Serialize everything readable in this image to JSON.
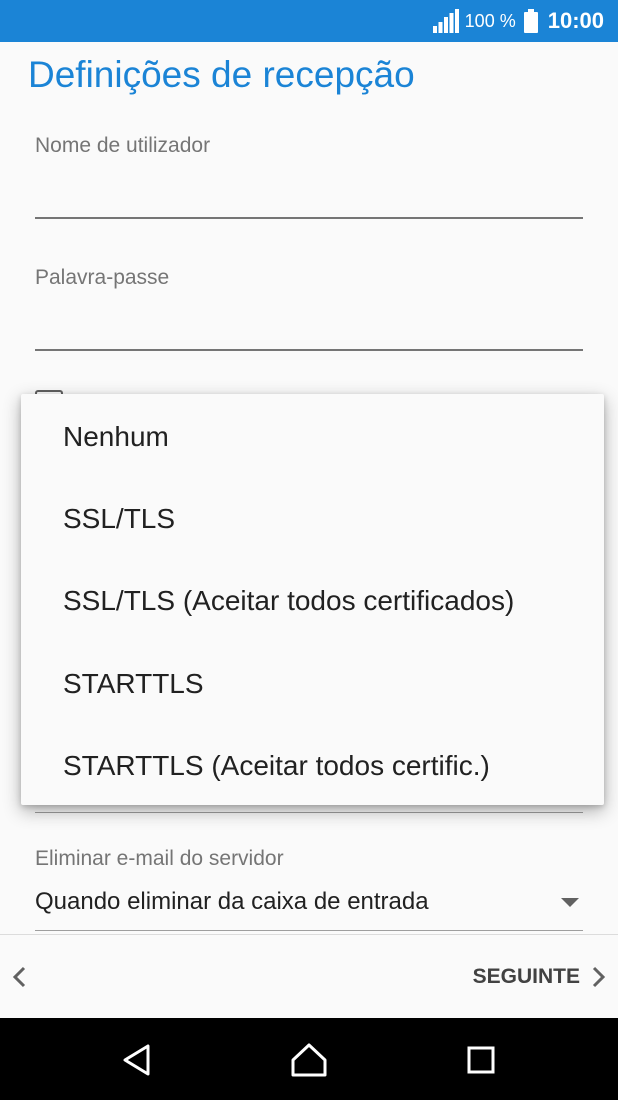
{
  "status_bar": {
    "battery_percent": "100 %",
    "time": "10:00",
    "signal_icon": "signal-bars-icon",
    "battery_icon": "battery-full-icon",
    "background_color": "#1b84d6"
  },
  "page": {
    "title": "Definições de recepção",
    "accent_color": "#1b84d6"
  },
  "form": {
    "username": {
      "label": "Nome de utilizador",
      "value": ""
    },
    "password": {
      "label": "Palavra-passe",
      "value": ""
    },
    "delete_email": {
      "label": "Eliminar e-mail do servidor",
      "value": "Quando eliminar da caixa de entrada"
    }
  },
  "security_menu": {
    "options": [
      "Nenhum",
      "SSL/TLS",
      "SSL/TLS (Aceitar todos certificados)",
      "STARTTLS",
      "STARTTLS (Aceitar todos certific.)"
    ]
  },
  "bottom_bar": {
    "next_label": "SEGUINTE",
    "back_icon": "chevron-left-icon",
    "next_icon": "chevron-right-icon"
  },
  "system_nav": {
    "back_icon": "triangle-back-icon",
    "home_icon": "home-icon",
    "recents_icon": "square-recents-icon"
  }
}
